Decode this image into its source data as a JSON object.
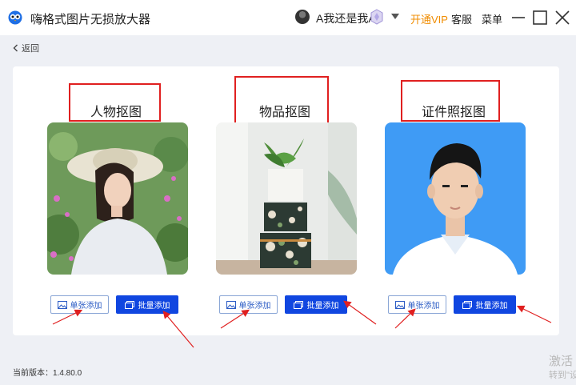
{
  "window": {
    "title": "嗨格式图片无损放大器",
    "user_name": "A我还是我A",
    "open_vip": "开通VIP",
    "service": "客服",
    "menu": "菜单"
  },
  "nav": {
    "back_label": "返回"
  },
  "options": [
    {
      "title": "人物抠图",
      "single_label": "单张添加",
      "batch_label": "批量添加",
      "image": "portrait-woman-with-hat"
    },
    {
      "title": "物品抠图",
      "single_label": "单张添加",
      "batch_label": "批量添加",
      "image": "plant-on-boxes"
    },
    {
      "title": "证件照抠图",
      "single_label": "单张添加",
      "batch_label": "批量添加",
      "image": "id-photo-man"
    }
  ],
  "footer": {
    "version": "当前版本：1.4.80.0"
  },
  "watermark": {
    "line1": "激活",
    "line2": "转到\"设"
  },
  "colors": {
    "accent": "#1046e0",
    "vip": "#f08c00",
    "annotation": "#e02020",
    "id_photo_bg": "#3f9bf5"
  }
}
